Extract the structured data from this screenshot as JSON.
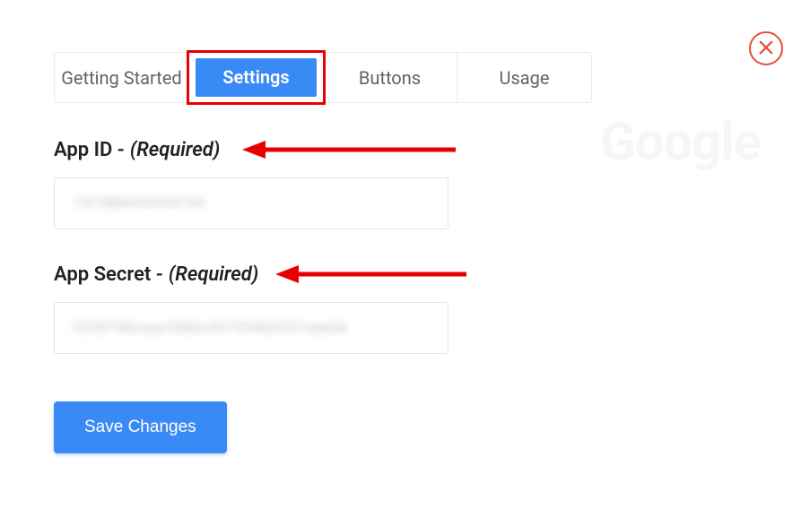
{
  "brand": "Google",
  "tabs": {
    "items": [
      {
        "label": "Getting Started",
        "active": false
      },
      {
        "label": "Settings",
        "active": true
      },
      {
        "label": "Buttons",
        "active": false
      },
      {
        "label": "Usage",
        "active": false
      }
    ]
  },
  "fields": {
    "appId": {
      "labelPrefix": "App ID - ",
      "required": "(Required)",
      "value": "741088455955744"
    },
    "appSecret": {
      "labelPrefix": "App Secret - ",
      "required": "(Required)",
      "value": "325074bcaacf580c457294b0201eee0e"
    }
  },
  "actions": {
    "save": "Save Changes"
  }
}
